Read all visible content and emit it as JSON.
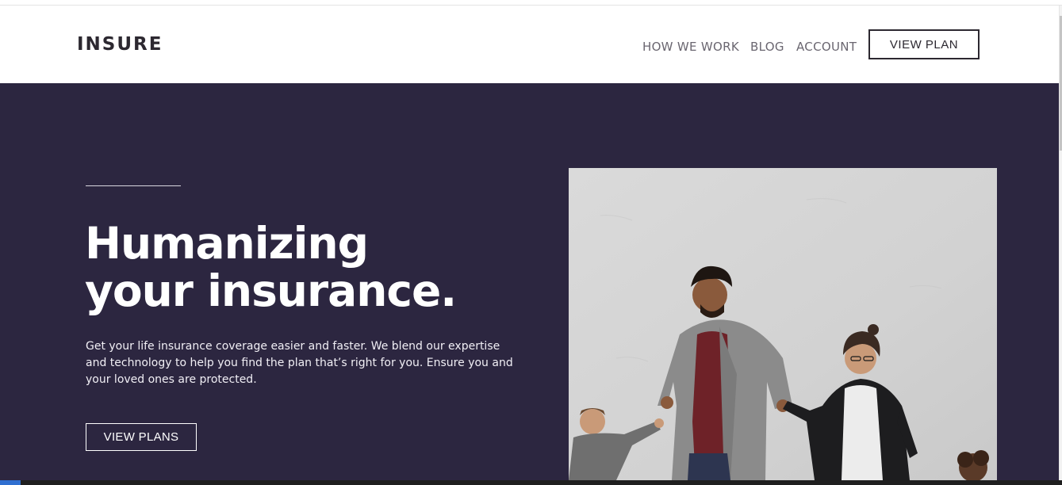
{
  "header": {
    "logo": "INSURE",
    "nav": [
      {
        "label": "HOW WE WORK"
      },
      {
        "label": "BLOG"
      },
      {
        "label": "ACCOUNT"
      }
    ],
    "cta_label": "VIEW PLAN"
  },
  "hero": {
    "title_line1": "Humanizing",
    "title_line2": "your insurance.",
    "description": "Get your life insurance coverage easier and faster. We blend our expertise and technology to help you find the plan that’s right for you. Ensure you and your loved ones are protected.",
    "cta_label": "VIEW PLANS",
    "image": "family-walking-photo"
  },
  "colors": {
    "hero_bg": "#2c2640",
    "text_dark": "#2c2830",
    "nav_text": "#6a6670"
  }
}
